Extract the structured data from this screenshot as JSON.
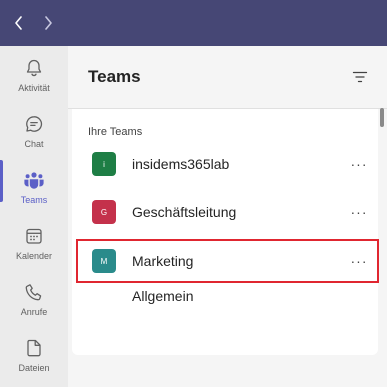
{
  "nav": {
    "back_icon": "chevron-left-icon",
    "forward_icon": "chevron-right-icon"
  },
  "rail": {
    "items": [
      {
        "label": "Aktivität",
        "icon": "bell-icon"
      },
      {
        "label": "Chat",
        "icon": "chat-icon"
      },
      {
        "label": "Teams",
        "icon": "teams-icon",
        "active": true
      },
      {
        "label": "Kalender",
        "icon": "calendar-icon"
      },
      {
        "label": "Anrufe",
        "icon": "phone-icon"
      },
      {
        "label": "Dateien",
        "icon": "file-icon"
      }
    ]
  },
  "panel": {
    "title": "Teams",
    "filter_icon": "filter-icon",
    "section_label": "Ihre Teams",
    "teams": [
      {
        "name": "insidems365lab",
        "initial": "i",
        "color": "#1e7e45"
      },
      {
        "name": "Geschäftsleitung",
        "initial": "G",
        "color": "#c4314b"
      },
      {
        "name": "Marketing",
        "initial": "M",
        "color": "#2a8b8b"
      }
    ],
    "more_label": "···",
    "channel": "Allgemein"
  },
  "colors": {
    "titlebar": "#464775",
    "accent": "#5b5fc7",
    "highlight": "#e02630"
  }
}
